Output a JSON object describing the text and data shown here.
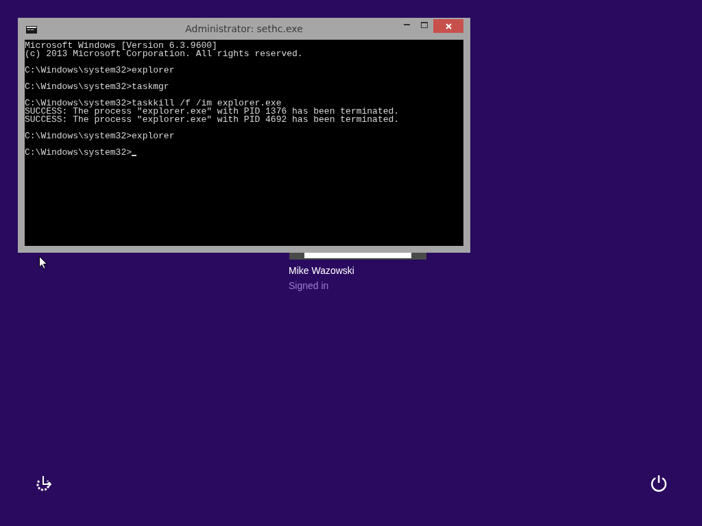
{
  "window": {
    "title": "Administrator: sethc.exe",
    "console": {
      "blocks": [
        [
          "Microsoft Windows [Version 6.3.9600]",
          "(c) 2013 Microsoft Corporation. All rights reserved."
        ],
        [
          "C:\\Windows\\system32>explorer"
        ],
        [
          "C:\\Windows\\system32>taskmgr"
        ],
        [
          "C:\\Windows\\system32>taskkill /f /im explorer.exe",
          "SUCCESS: The process \"explorer.exe\" with PID 1376 has been terminated.",
          "SUCCESS: The process \"explorer.exe\" with PID 4692 has been terminated."
        ],
        [
          "C:\\Windows\\system32>explorer"
        ],
        [
          "C:\\Windows\\system32>"
        ]
      ],
      "cursor": true
    }
  },
  "user": {
    "name": "Mike Wazowski",
    "status": "Signed in"
  }
}
